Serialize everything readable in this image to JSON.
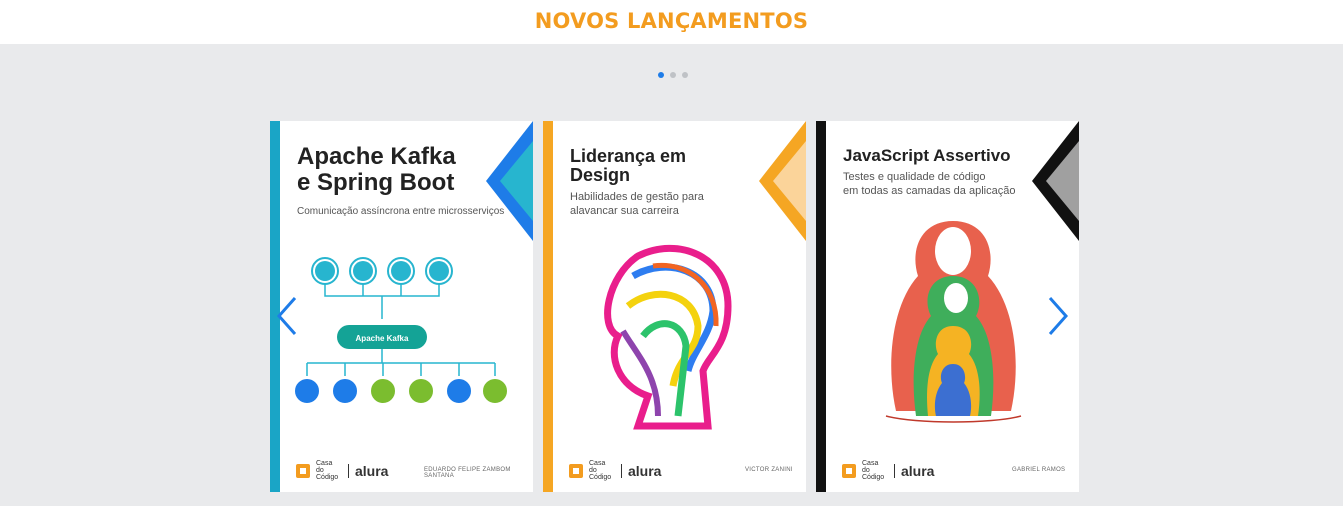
{
  "section": {
    "title": "NOVOS LANÇAMENTOS"
  },
  "carousel": {
    "pages": 3,
    "current_page": 1,
    "books": [
      {
        "title_line1": "Apache Kafka",
        "title_line2": "e Spring Boot",
        "subtitle_line1": "Comunicação assíncrona entre microsserviços",
        "subtitle_line2": "",
        "author": "EDUARDO FELIPE ZAMBOM SANTANA",
        "accent_color": "#1aa5c6",
        "diagram_center_label": "Apache Kafka"
      },
      {
        "title_line1": "Liderança em",
        "title_line2": "Design",
        "subtitle_line1": "Habilidades de gestão para",
        "subtitle_line2": "alavancar sua carreira",
        "author": "VICTOR ZANINI",
        "accent_color": "#f5a623"
      },
      {
        "title_line1": "JavaScript Assertivo",
        "title_line2": "",
        "subtitle_line1": "Testes e qualidade de código",
        "subtitle_line2": "em todas as camadas da aplicação",
        "author": "GABRIEL RAMOS",
        "accent_color": "#111111"
      }
    ],
    "brand": {
      "publisher": "Casa do Código",
      "partner": "alura"
    }
  },
  "colors": {
    "accent": "#f39c1f",
    "arrow": "#1e7ce8",
    "dot_active": "#1e7ce8",
    "dot_inactive": "#bfc2c6"
  },
  "icons": {
    "prev": "chevron-left-icon",
    "next": "chevron-right-icon"
  }
}
